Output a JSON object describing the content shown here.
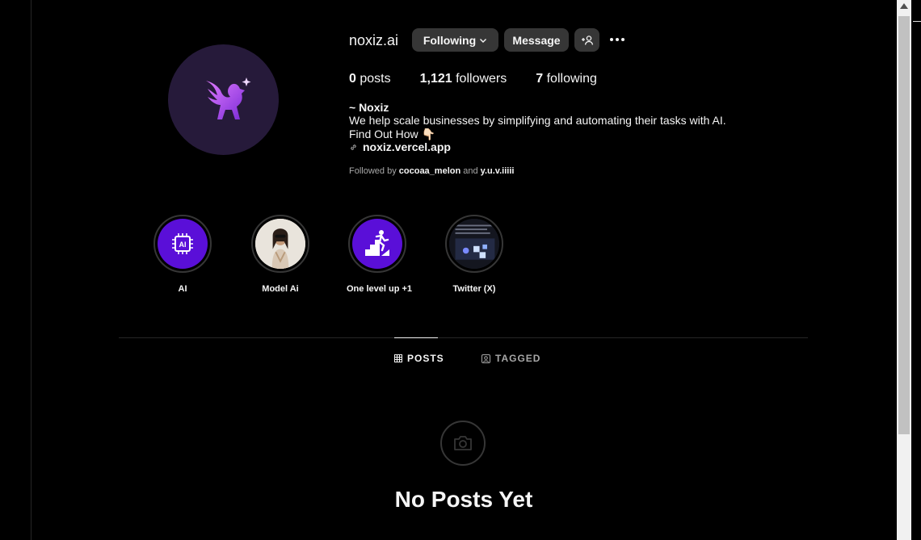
{
  "profile": {
    "username": "noxiz.ai",
    "following_btn": "Following",
    "message_btn": "Message",
    "stats": {
      "posts_count": "0",
      "posts_label": "posts",
      "followers_count": "1,121",
      "followers_label": "followers",
      "following_count": "7",
      "following_label": "following"
    },
    "bio": {
      "name": "~ Noxiz",
      "line1": "We help scale businesses by simplifying and automating their tasks with AI.",
      "line2": "Find Out How 👇🏻",
      "link": "noxiz.vercel.app"
    },
    "followed_by": {
      "prefix": "Followed by",
      "user1": "cocoaa_melon",
      "conj": "and",
      "user2": "y.u.v.iiiii"
    }
  },
  "highlights": [
    {
      "label": "AI",
      "icon": "ai-chip-icon",
      "color": "#5a0fd8"
    },
    {
      "label": "Model Ai",
      "icon": "model-photo",
      "color": "#e9e4dc"
    },
    {
      "label": "One level up +1",
      "icon": "stairs-runner-icon",
      "color": "#5a0fd8"
    },
    {
      "label": "Twitter (X)",
      "icon": "twitter-screenshot",
      "color": "#1a1d2a"
    }
  ],
  "tabs": {
    "posts": "POSTS",
    "tagged": "TAGGED"
  },
  "empty_state": {
    "title": "No Posts Yet",
    "icon": "camera-icon"
  },
  "colors": {
    "background": "#000000",
    "button": "#363636",
    "accent_purple": "#5a0fd8"
  }
}
